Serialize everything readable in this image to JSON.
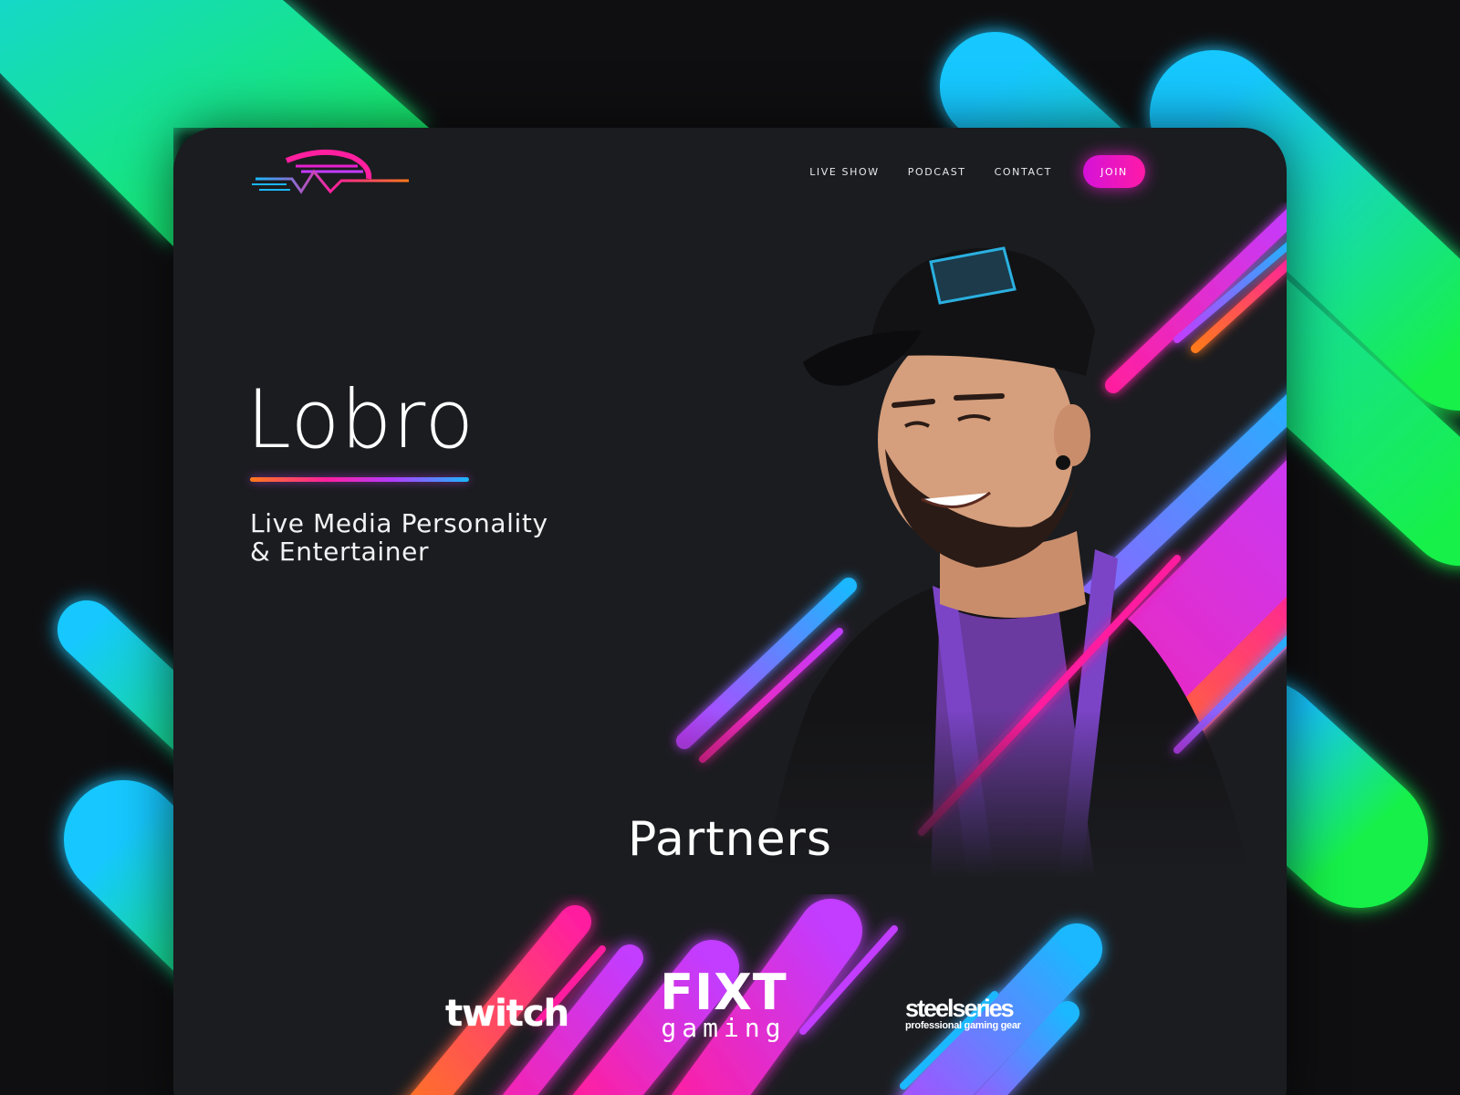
{
  "brand": {
    "logo_icon": "helmet-speed-logo-icon",
    "accent_colors": [
      "#ff7a1a",
      "#ff1f9f",
      "#c23cff",
      "#1ab8ff",
      "#12f04a"
    ]
  },
  "nav": {
    "items": [
      {
        "label": "LIVE SHOW"
      },
      {
        "label": "PODCAST"
      },
      {
        "label": "CONTACT"
      }
    ],
    "join_label": "JOIN"
  },
  "hero": {
    "title": "Lobro",
    "subtitle_line1": "Live Media Personality",
    "subtitle_line2": "& Entertainer"
  },
  "partners": {
    "title": "Partners",
    "logos": [
      {
        "name": "twitch"
      },
      {
        "name_top": "FIXT",
        "name_bottom": "gaming"
      },
      {
        "name_top": "steelseries",
        "name_bottom": "professional gaming gear"
      }
    ]
  }
}
